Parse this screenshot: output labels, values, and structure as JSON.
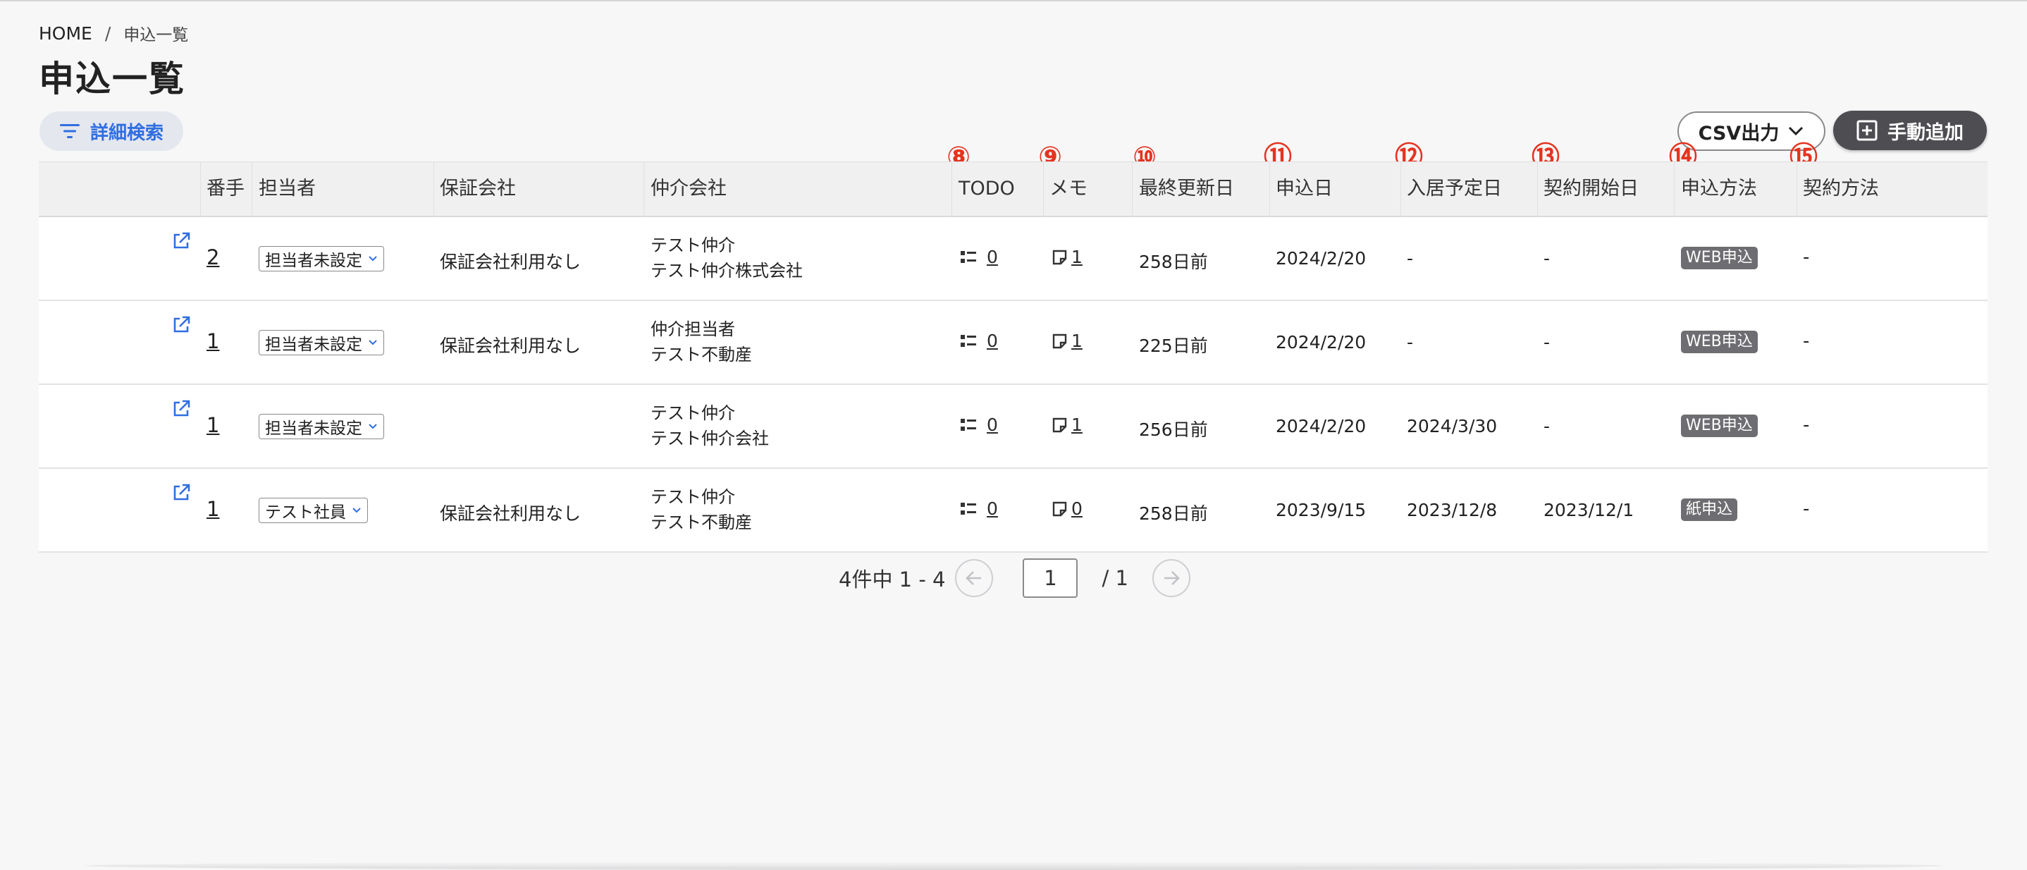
{
  "breadcrumb": {
    "home": "HOME",
    "separator": "/",
    "current": "申込一覧"
  },
  "page_title": "申込一覧",
  "toolbar": {
    "filter_label": "詳細検索",
    "filter_icon": "filter-icon",
    "csv_label": "CSV出力",
    "add_label": "手動追加",
    "accent_color": "#2f6ee0"
  },
  "markers": [
    "⑧",
    "⑨",
    "⑩",
    "⑪",
    "⑫",
    "⑬",
    "⑭",
    "⑮"
  ],
  "columns": {
    "number": "番手",
    "assignee": "担当者",
    "guarantor": "保証会社",
    "broker": "仲介会社",
    "todo": "TODO",
    "memo": "メモ",
    "updated": "最終更新日",
    "application_date": "申込日",
    "move_in": "入居予定日",
    "contract_start": "契約開始日",
    "app_method": "申込方法",
    "contract_method": "契約方法"
  },
  "rows": [
    {
      "number": "2",
      "assignee": "担当者未設定",
      "guarantor": "保証会社利用なし",
      "broker_line1": "テスト仲介",
      "broker_line2": "テスト仲介株式会社",
      "todo": "0",
      "memo": "1",
      "updated": "258日前",
      "application_date": "2024/2/20",
      "move_in": "-",
      "contract_start": "-",
      "app_method": "WEB申込",
      "contract_method": "-"
    },
    {
      "number": "1",
      "assignee": "担当者未設定",
      "guarantor": "保証会社利用なし",
      "broker_line1": "仲介担当者",
      "broker_line2": "テスト不動産",
      "todo": "0",
      "memo": "1",
      "updated": "225日前",
      "application_date": "2024/2/20",
      "move_in": "-",
      "contract_start": "-",
      "app_method": "WEB申込",
      "contract_method": "-"
    },
    {
      "number": "1",
      "assignee": "担当者未設定",
      "guarantor": "",
      "broker_line1": "テスト仲介",
      "broker_line2": "テスト仲介会社",
      "todo": "0",
      "memo": "1",
      "updated": "256日前",
      "application_date": "2024/2/20",
      "move_in": "2024/3/30",
      "contract_start": "-",
      "app_method": "WEB申込",
      "contract_method": "-"
    },
    {
      "number": "1",
      "assignee": "テスト社員",
      "guarantor": "保証会社利用なし",
      "broker_line1": "テスト仲介",
      "broker_line2": "テスト不動産",
      "todo": "0",
      "memo": "0",
      "updated": "258日前",
      "application_date": "2023/9/15",
      "move_in": "2023/12/8",
      "contract_start": "2023/12/1",
      "app_method": "紙申込",
      "contract_method": "-"
    }
  ],
  "pagination": {
    "summary": "4件中 1 - 4",
    "current_page": "1",
    "total": "/ 1"
  }
}
